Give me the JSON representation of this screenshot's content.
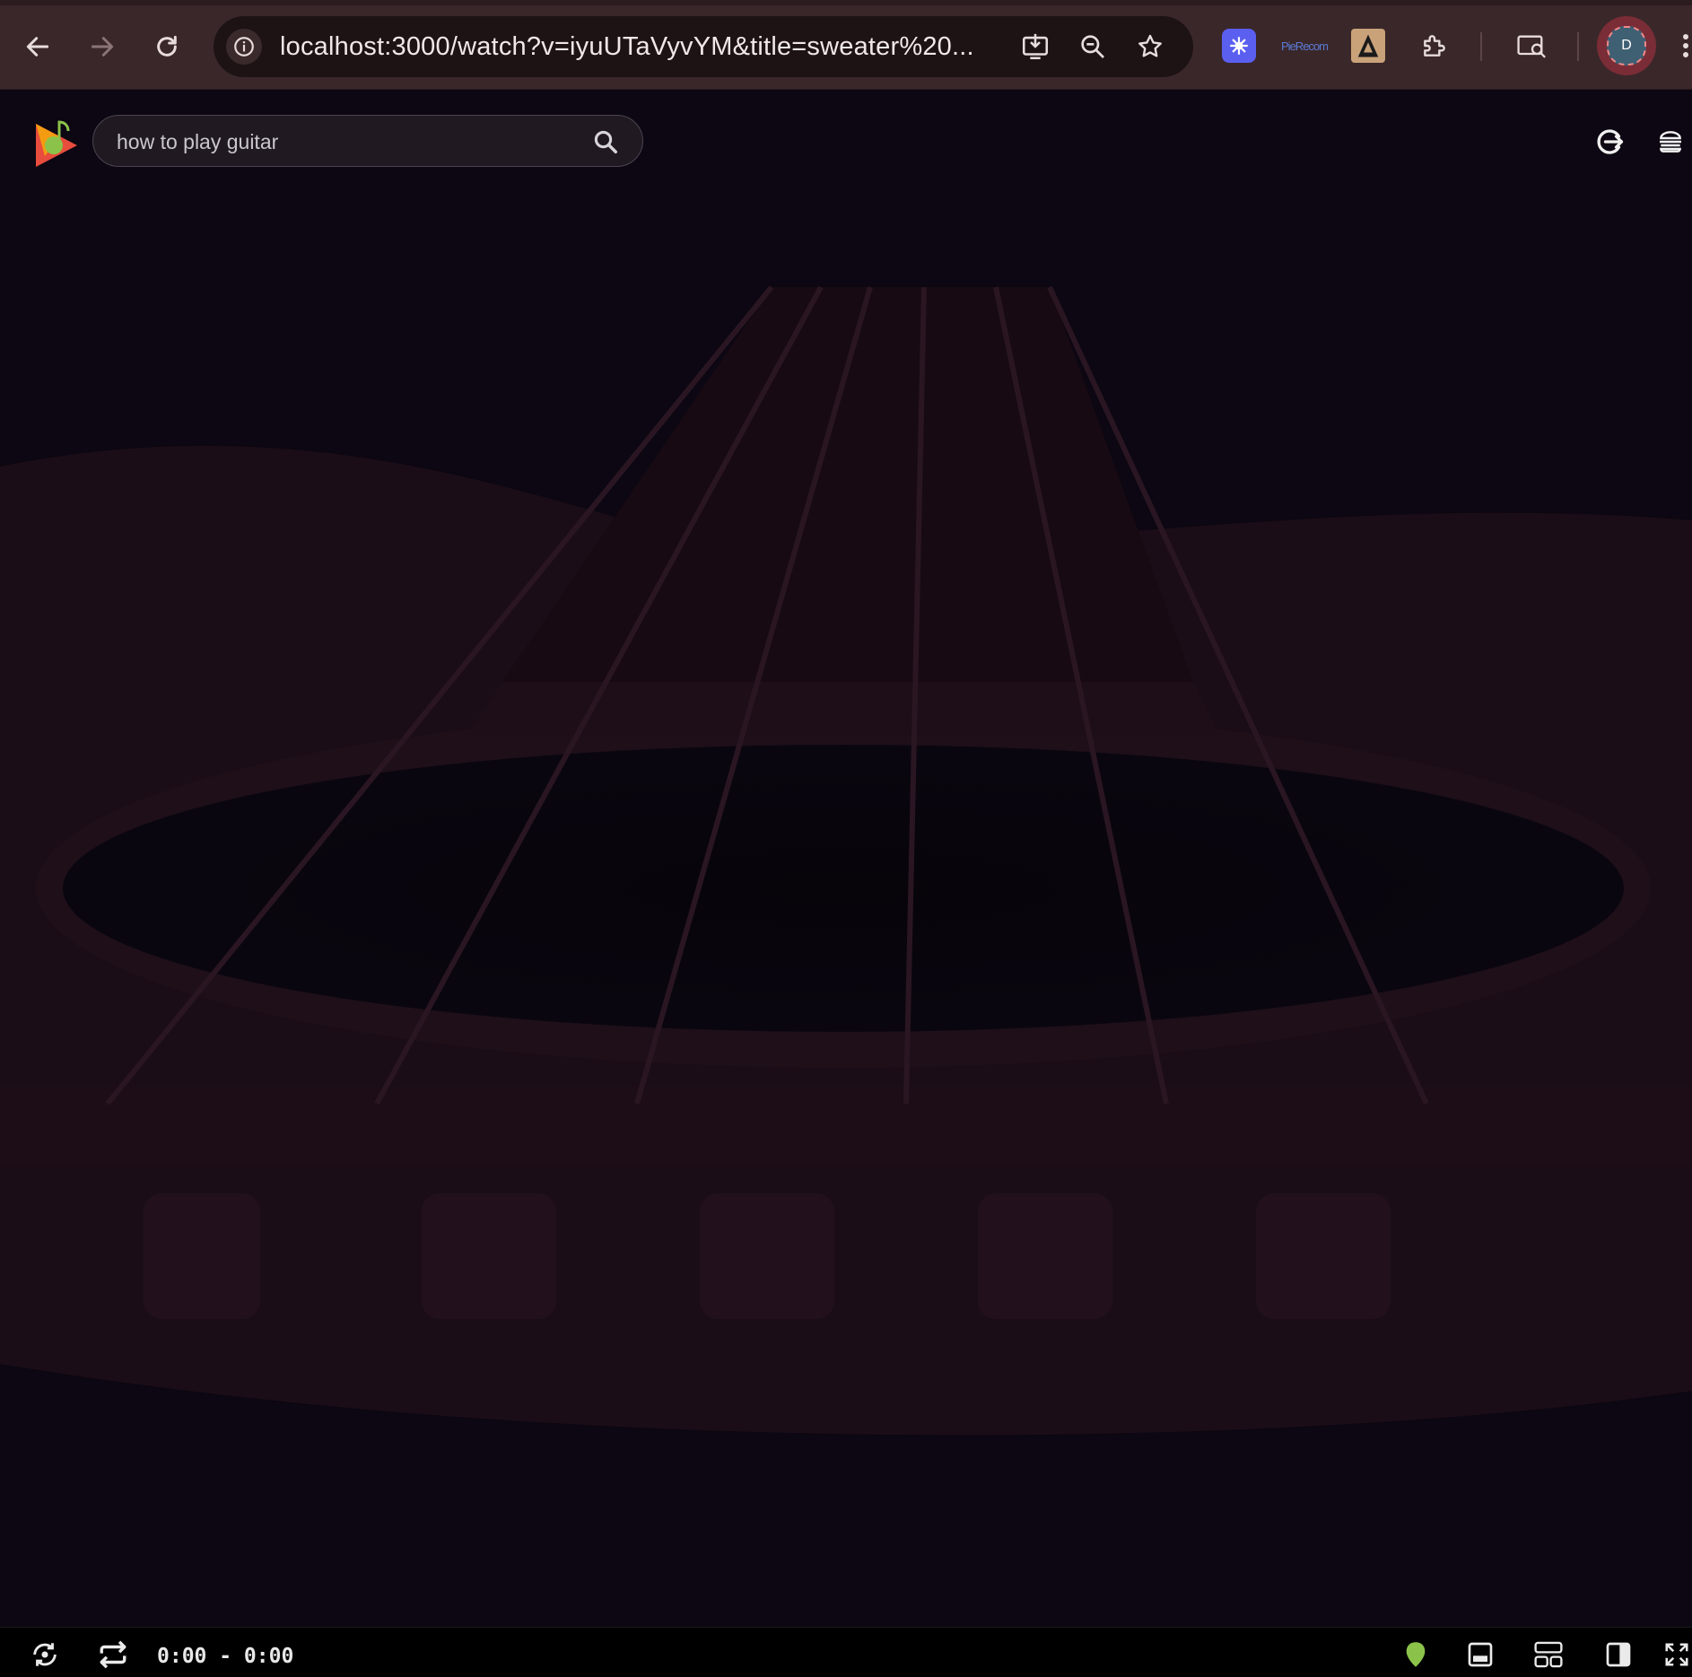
{
  "browser": {
    "url": "localhost:3000/watch?v=iyuUTaVyvYM&title=sweater%20...",
    "profile_initial": "D",
    "nav": {
      "back_icon": "arrow-left-icon",
      "forward_icon": "arrow-right-icon",
      "reload_icon": "reload-icon"
    },
    "omnibox_actions": [
      "install-app-icon",
      "zoom-icon",
      "bookmark-star-icon"
    ],
    "extensions": [
      "perplexity-extension-icon",
      "cookie-extension-icon",
      "vpn-extension-icon",
      "puzzle-extensions-icon"
    ],
    "extension_label": "PieRecom",
    "extra": [
      "tab-search-icon",
      "kebab-menu-icon"
    ]
  },
  "app": {
    "search": {
      "value": "how to play guitar",
      "icon": "search-icon"
    },
    "header_icons": [
      "logout-icon",
      "menu-icon"
    ],
    "logo": "music-play-logo"
  },
  "player": {
    "time": "0:00 - 0:00",
    "left_controls": [
      "shuffle-icon",
      "repeat-icon"
    ],
    "right_controls": [
      "status-indicator-icon",
      "mini-player-icon",
      "layout-icon",
      "sidebar-toggle-icon",
      "fullscreen-icon"
    ],
    "accent": "#8bc34a"
  }
}
